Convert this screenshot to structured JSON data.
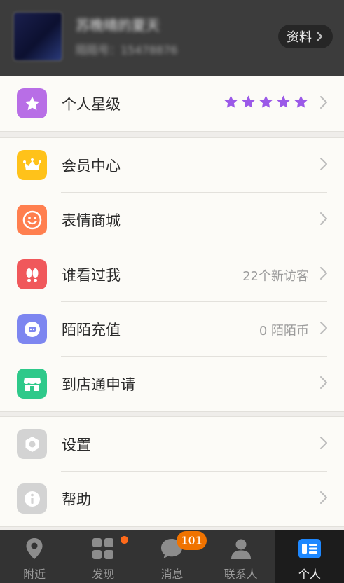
{
  "header": {
    "name": "苏晚晴的夏天",
    "id_text": "陌陌号：15478876",
    "profile_button": "资料"
  },
  "rating": {
    "label": "个人星级",
    "stars": 5,
    "star_color": "#9b59e8"
  },
  "menu": [
    {
      "label": "会员中心",
      "value": "",
      "icon": "crown-icon",
      "color": "#ffc21a"
    },
    {
      "label": "表情商城",
      "value": "",
      "icon": "smiley-icon",
      "color": "#ff7f4f"
    },
    {
      "label": "谁看过我",
      "value": "22个新访客",
      "icon": "footprints-icon",
      "color": "#f0585b"
    },
    {
      "label": "陌陌充值",
      "value": "0 陌陌币",
      "icon": "coin-icon",
      "color": "#7d86f0"
    },
    {
      "label": "到店通申请",
      "value": "",
      "icon": "store-icon",
      "color": "#2ec98a"
    }
  ],
  "settings": [
    {
      "label": "设置",
      "icon": "gear-icon",
      "color": "#d3d3d3"
    },
    {
      "label": "帮助",
      "icon": "info-icon",
      "color": "#d3d3d3"
    }
  ],
  "tabbar": {
    "tabs": [
      {
        "label": "附近",
        "icon": "location-pin-icon"
      },
      {
        "label": "发现",
        "icon": "grid-icon"
      },
      {
        "label": "消息",
        "icon": "chat-bubble-icon"
      },
      {
        "label": "联系人",
        "icon": "person-icon"
      },
      {
        "label": "个人",
        "icon": "profile-card-icon"
      }
    ],
    "messages_badge": "101",
    "active_tab": "个人",
    "accent": "#1e88ff"
  }
}
